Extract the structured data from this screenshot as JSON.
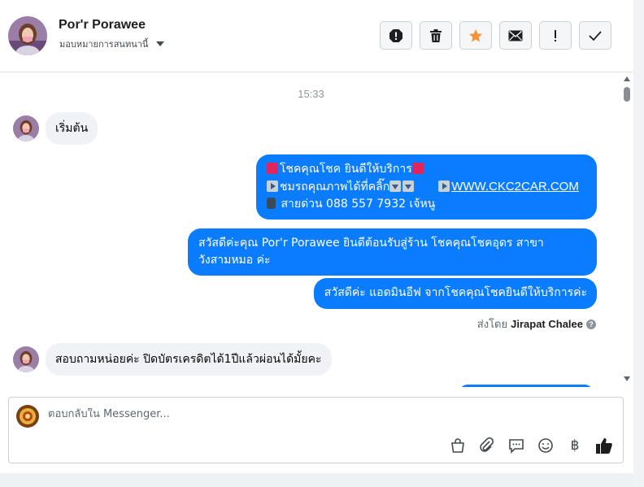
{
  "header": {
    "name": "Por'r Porawee",
    "subtitle": "มอบหมายการสนทนานี้"
  },
  "actions": [
    {
      "name": "report-spam",
      "icon": "alert-octagon-icon"
    },
    {
      "name": "delete",
      "icon": "trash-icon"
    },
    {
      "name": "star",
      "icon": "star-icon",
      "color": "#f7923b"
    },
    {
      "name": "mark-unread",
      "icon": "envelope-icon"
    },
    {
      "name": "follow-up",
      "icon": "exclamation-icon"
    },
    {
      "name": "mark-done",
      "icon": "check-icon"
    }
  ],
  "messages": {
    "timestamp": "15:33",
    "m1": "เริ่มต้น",
    "m2": {
      "l1": "โชคคุณโชค ยินดีให้บริการ",
      "l2a": "ชมรถคุณภาพได้ที่คลิ๊ก",
      "l2link": "WWW.CKC2CAR.COM",
      "l3": "สายด่วน 088 557 7932 เจ้หนู"
    },
    "m3": {
      "l1": "สวัสดีค่ะคุณ Por'r Porawee ยินดีต้อนรับสู่ร้าน โชคคุณโชคอุดร สาขา",
      "l2": "วังสามหมอ ค่ะ"
    },
    "m4": "สวัสดีค่ะ แอดมินอีฟ จากโชคคุณโชคยินดีให้บริการค่ะ",
    "sent_by_label": "ส่งโดย",
    "sent_by_name": "Jirapat Chalee",
    "m5": "สอบถามหน่อยค่ะ  ปิดบัตรเครดิตได้1ปีแล้วผ่อนได้มั้ยคะ"
  },
  "composer": {
    "placeholder": "ตอบกลับใน Messenger...",
    "value": "",
    "baht": "฿"
  },
  "colors": {
    "outgoing": "#0a7cff",
    "incoming": "#f0f2f5"
  }
}
